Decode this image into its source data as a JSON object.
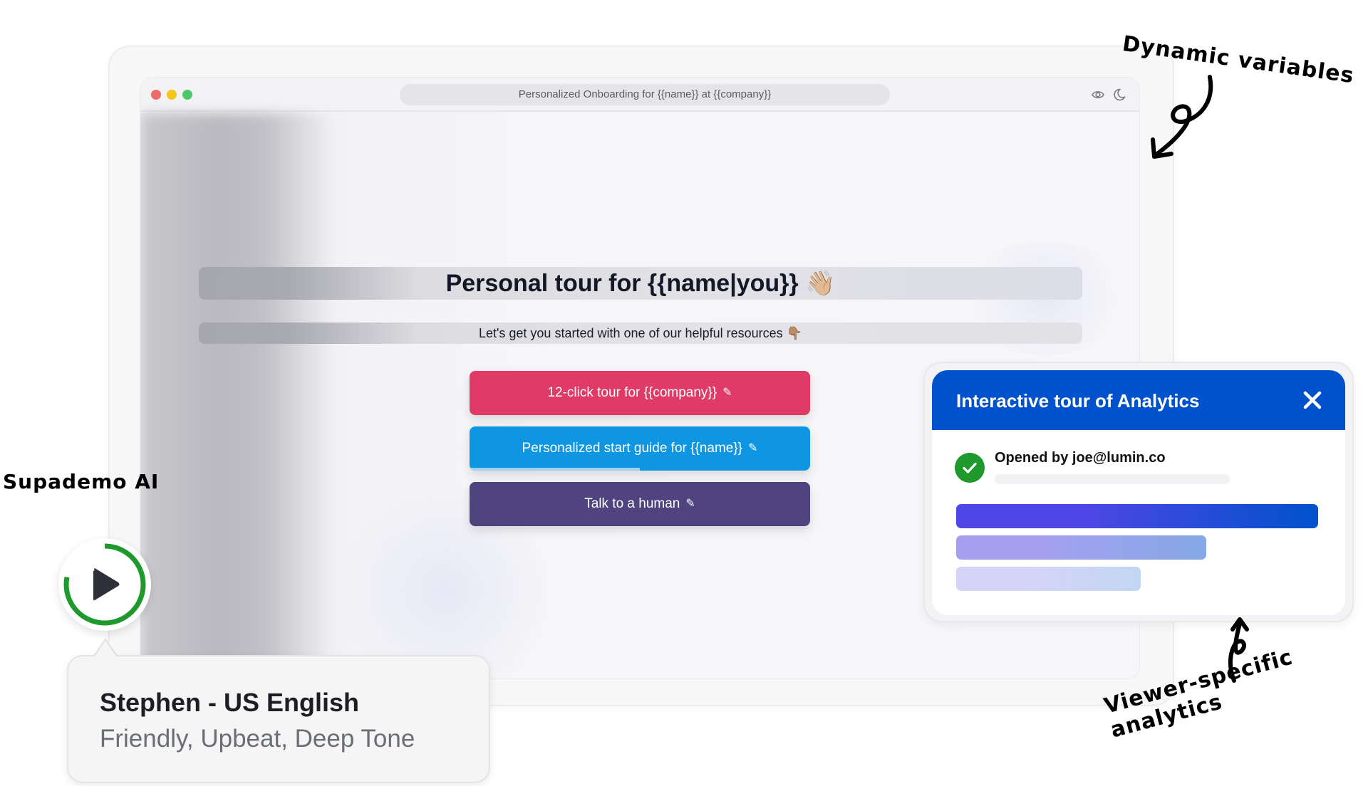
{
  "browser": {
    "url_title": "Personalized Onboarding for {{name}} at {{company}}",
    "icons": [
      "eye-icon",
      "moon-icon"
    ],
    "traffic_lights": [
      "#ef6a6a",
      "#f5c518",
      "#4cc76a"
    ]
  },
  "page": {
    "heading": "Personal tour for {{name|you}} 👋🏼",
    "subheading": "Let's get you started with one of our helpful resources 👇🏽",
    "buttons": [
      {
        "label": "12-click tour for {{company}}",
        "icon": "pencil-icon",
        "color": "#df3b66"
      },
      {
        "label": "Personalized start guide for {{name}}",
        "icon": "pencil-icon",
        "color": "#0e96e2",
        "progress_fraction": 0.5
      },
      {
        "label": "Talk to a human",
        "icon": "pencil-icon",
        "color": "#4f447f"
      }
    ]
  },
  "analytics": {
    "title": "Interactive tour of Analytics",
    "close_icon": "close-icon",
    "opened_by": "Opened by joe@lumin.co",
    "header_color": "#0052cc",
    "bars": [
      {
        "fraction": 1.0,
        "from": "#4f46e5",
        "to": "#0052cc"
      },
      {
        "fraction": 0.69,
        "from": "#a5a0ee",
        "to": "#85a8e6"
      },
      {
        "fraction": 0.51,
        "from": "#d6d4f6",
        "to": "#c2d6f4"
      }
    ]
  },
  "annotations": {
    "dynamic_variables": "Dynamic variables",
    "viewer_analytics": "Viewer-specific analytics",
    "supademo_ai": "Supademo AI"
  },
  "voice": {
    "name": "Stephen - US English",
    "description": "Friendly, Upbeat, Deep Tone",
    "progress_fraction": 0.78,
    "progress_color": "#1e9a2c"
  }
}
